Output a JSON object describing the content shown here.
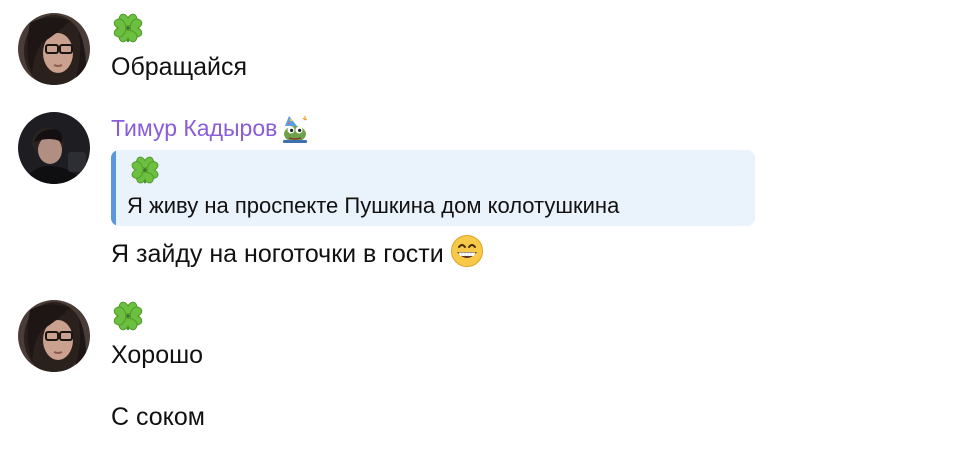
{
  "messages": [
    {
      "avatar_icon": "user-avatar-female-glasses",
      "clover_icon": "four-leaf-clover-emoji",
      "text": "Обращайся"
    },
    {
      "avatar_icon": "user-avatar-male-dark",
      "author": "Тимур Кадыров",
      "author_color": "#8a5cd8",
      "badge_icon": "party-frog-emoji",
      "reply": {
        "clover_icon": "four-leaf-clover-emoji",
        "text": "Я живу на проспекте Пушкина дом колотушкина",
        "bar_color": "#5b97dd",
        "background": "#eaf2fc"
      },
      "text": "Я зайду на ноготочки в гости",
      "emoji_icon": "grinning-face-emoji"
    },
    {
      "avatar_icon": "user-avatar-female-glasses",
      "clover_icon": "four-leaf-clover-emoji",
      "text": "Хорошо",
      "followup_text": "С соком"
    }
  ]
}
